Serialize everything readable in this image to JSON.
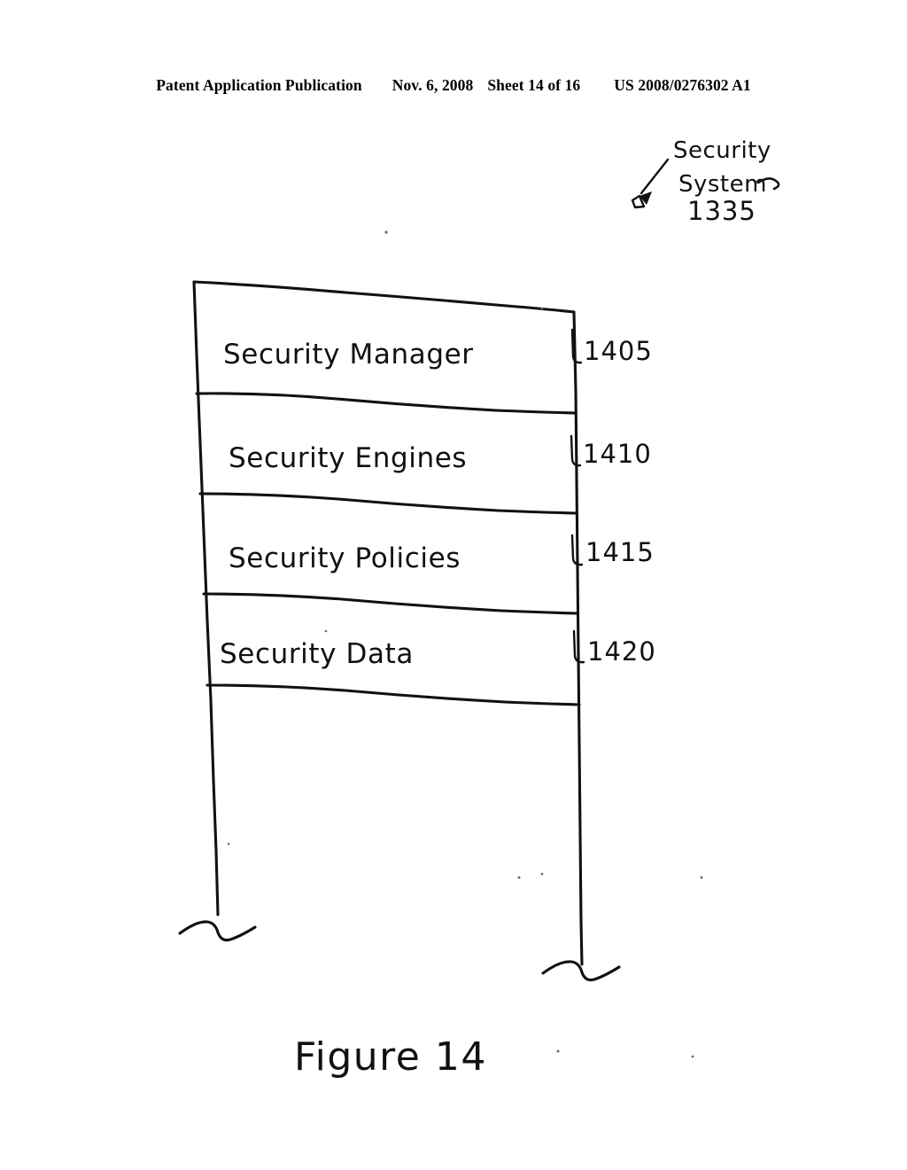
{
  "header": {
    "publication": "Patent Application Publication",
    "date": "Nov. 6, 2008",
    "sheet": "Sheet 14 of 16",
    "document_number": "US 2008/0276302 A1"
  },
  "figure": {
    "caption": "Figure 14",
    "callout": {
      "line1": "Security",
      "line2": "System",
      "line3": "1335",
      "icon": "leader-arrow-icon"
    },
    "rows": [
      {
        "label": "Security Manager",
        "ref": "1405"
      },
      {
        "label": "Security Engines",
        "ref": "1410"
      },
      {
        "label": "Security Policies",
        "ref": "1415"
      },
      {
        "label": "Security Data",
        "ref": "1420"
      }
    ],
    "break_lines": [
      "left-break-squiggle",
      "right-break-squiggle"
    ],
    "colors": {
      "ink": "#111111",
      "paper": "#ffffff"
    }
  }
}
